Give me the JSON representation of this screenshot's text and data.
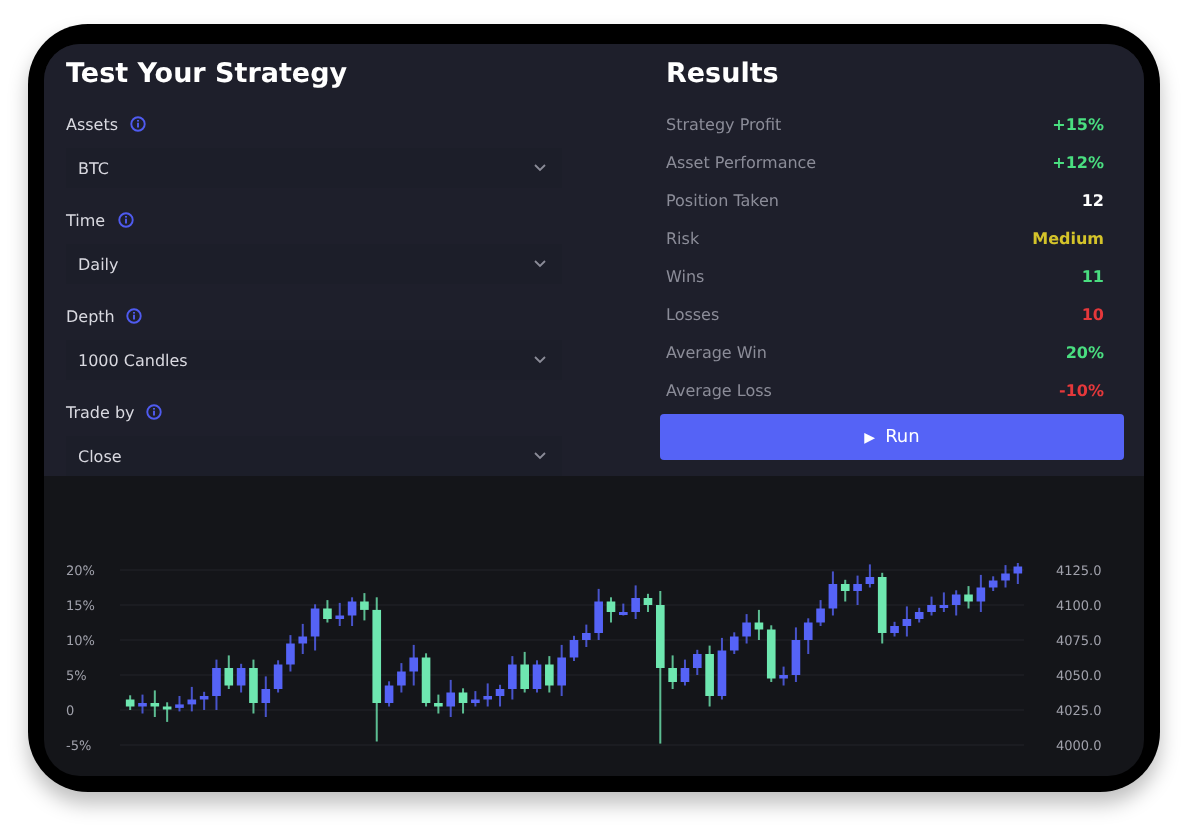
{
  "strategy": {
    "title": "Test Your Strategy",
    "fields": [
      {
        "label": "Assets",
        "value": "BTC"
      },
      {
        "label": "Time",
        "value": "Daily"
      },
      {
        "label": "Depth",
        "value": "1000 Candles"
      },
      {
        "label": "Trade by",
        "value": "Close"
      }
    ]
  },
  "results": {
    "title": "Results",
    "rows": [
      {
        "label": "Strategy Profit",
        "value": "+15%",
        "color": "#4ade80"
      },
      {
        "label": "Asset Performance",
        "value": "+12%",
        "color": "#4ade80"
      },
      {
        "label": "Position Taken",
        "value": "12",
        "color": "#ffffff"
      },
      {
        "label": "Risk",
        "value": "Medium",
        "color": "#d4c32a"
      },
      {
        "label": "Wins",
        "value": "11",
        "color": "#4ade80"
      },
      {
        "label": "Losses",
        "value": "10",
        "color": "#e5383b"
      },
      {
        "label": "Average Win",
        "value": "20%",
        "color": "#4ade80"
      },
      {
        "label": "Average Loss",
        "value": "-10%",
        "color": "#e5383b"
      }
    ],
    "run_button": {
      "icon": "▶",
      "label": "Run"
    }
  },
  "chart": {
    "right_axis": [
      "4125.0",
      "4100.0",
      "4075.0",
      "4050.0",
      "4025.0",
      "4000.0"
    ],
    "chart_data": {
      "type": "candlestick",
      "grid": true,
      "ylim": [
        -5,
        20
      ],
      "yticks": [
        {
          "value": 20,
          "label": "20%"
        },
        {
          "value": 15,
          "label": "15%"
        },
        {
          "value": 10,
          "label": "10%"
        },
        {
          "value": 5,
          "label": "5%"
        },
        {
          "value": 0,
          "label": "0"
        },
        {
          "value": -5,
          "label": "-5%"
        }
      ],
      "ohlc": [
        [
          1.5,
          2.1,
          0,
          0.5
        ],
        [
          0.5,
          2.2,
          -0.5,
          1
        ],
        [
          1,
          2.8,
          -1,
          0.5
        ],
        [
          0.5,
          1.1,
          -1.7,
          0.3
        ],
        [
          0.3,
          2,
          -0.2,
          0.8
        ],
        [
          0.8,
          3.3,
          -0.2,
          1.5
        ],
        [
          1.5,
          2.6,
          0,
          2
        ],
        [
          2,
          7.2,
          0,
          6
        ],
        [
          6,
          7.8,
          3,
          3.5
        ],
        [
          3.5,
          6.6,
          2.5,
          6
        ],
        [
          6,
          7.2,
          -0.5,
          1
        ],
        [
          1,
          4.8,
          -1,
          3
        ],
        [
          3,
          7.1,
          2.5,
          6.5
        ],
        [
          6.5,
          10.7,
          5.5,
          9.5
        ],
        [
          9.5,
          12.3,
          8,
          10.5
        ],
        [
          10.5,
          15.1,
          8.5,
          14.5
        ],
        [
          14.5,
          15.7,
          12.5,
          13
        ],
        [
          13,
          15.3,
          12,
          13.5
        ],
        [
          13.5,
          16.1,
          12,
          15.5
        ],
        [
          15.5,
          16.7,
          12.8,
          14.3
        ],
        [
          14.3,
          16.1,
          -4.5,
          1
        ],
        [
          1,
          4.1,
          0.5,
          3.5
        ],
        [
          3.5,
          6.7,
          2.5,
          5.5
        ],
        [
          5.5,
          9.3,
          3.5,
          7.5
        ],
        [
          7.5,
          8.1,
          0.5,
          1
        ],
        [
          1,
          2.2,
          -0.5,
          0.5
        ],
        [
          0.5,
          4.3,
          -1,
          2.5
        ],
        [
          2.5,
          3.1,
          -0.5,
          1
        ],
        [
          1,
          2.7,
          0.5,
          1.5
        ],
        [
          1.5,
          3.8,
          0.5,
          2
        ],
        [
          2,
          3.6,
          0.5,
          3
        ],
        [
          3,
          7.7,
          1.5,
          6.5
        ],
        [
          6.5,
          8.3,
          2.5,
          3
        ],
        [
          3,
          7.1,
          2.5,
          6.5
        ],
        [
          6.5,
          7.7,
          2.5,
          3.5
        ],
        [
          3.5,
          9.3,
          2,
          7.5
        ],
        [
          7.5,
          10.6,
          7,
          10
        ],
        [
          10,
          12.2,
          9,
          11
        ],
        [
          11,
          17.3,
          10,
          15.5
        ],
        [
          15.5,
          16.1,
          12.5,
          14
        ],
        [
          14,
          15.2,
          13.5,
          14
        ],
        [
          14,
          17.8,
          13,
          16
        ],
        [
          16,
          16.6,
          14,
          15
        ],
        [
          15,
          17,
          -4.8,
          6
        ],
        [
          6,
          7.8,
          3,
          4
        ],
        [
          4,
          7.2,
          3.5,
          6
        ],
        [
          6,
          8.6,
          5,
          8
        ],
        [
          8,
          9.2,
          0.5,
          2
        ],
        [
          2,
          10.3,
          1.5,
          8.5
        ],
        [
          8.5,
          11.1,
          8,
          10.5
        ],
        [
          10.5,
          13.7,
          9.5,
          12.5
        ],
        [
          12.5,
          14.3,
          10,
          11.5
        ],
        [
          11.5,
          12.1,
          4,
          4.5
        ],
        [
          4.5,
          6.2,
          3.5,
          5
        ],
        [
          5,
          11.8,
          4,
          10
        ],
        [
          10,
          13.1,
          8,
          12.5
        ],
        [
          12.5,
          15.7,
          12,
          14.5
        ],
        [
          14.5,
          19.8,
          13.5,
          18
        ],
        [
          18,
          18.6,
          15.5,
          17
        ],
        [
          17,
          19.2,
          15,
          18
        ],
        [
          18,
          20.8,
          17.5,
          19
        ],
        [
          19,
          19.6,
          9.5,
          11
        ],
        [
          11,
          12.6,
          10.5,
          12
        ],
        [
          12,
          14.8,
          10.5,
          13
        ],
        [
          13,
          14.6,
          12.5,
          14
        ],
        [
          14,
          16.2,
          13.5,
          15
        ],
        [
          15,
          16.8,
          14,
          15
        ],
        [
          15,
          17.1,
          13.5,
          16.5
        ],
        [
          16.5,
          17.7,
          14.5,
          15.5
        ],
        [
          15.5,
          19.3,
          14,
          17.5
        ],
        [
          17.5,
          19.1,
          17,
          18.5
        ],
        [
          18.5,
          20.7,
          17.5,
          19.5
        ],
        [
          19.5,
          21,
          18,
          20.5
        ]
      ]
    }
  }
}
